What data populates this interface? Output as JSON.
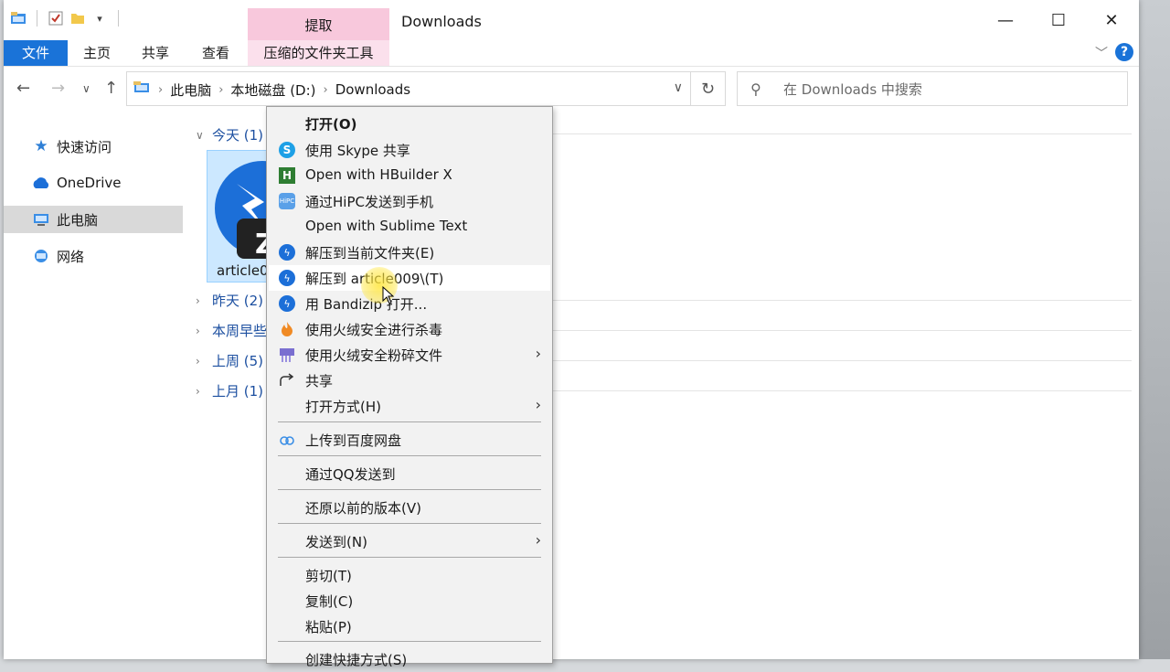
{
  "window": {
    "title": "Downloads",
    "context_tab": "提取",
    "minimize": "—",
    "maximize": "☐",
    "close": "✕"
  },
  "ribbon": {
    "tabs": [
      "文件",
      "主页",
      "共享",
      "查看",
      "压缩的文件夹工具"
    ],
    "help": "?"
  },
  "address": {
    "crumbs": [
      "此电脑",
      "本地磁盘 (D:)",
      "Downloads"
    ]
  },
  "search": {
    "placeholder": "在 Downloads 中搜索"
  },
  "nav_pane": {
    "items": [
      "快速访问",
      "OneDrive",
      "此电脑",
      "网络"
    ]
  },
  "content": {
    "groups": [
      "今天 (1)",
      "昨天 (2)",
      "本周早些",
      "上周 (5)",
      "上月 (1)"
    ],
    "file_label": "article0"
  },
  "context_menu": {
    "items": [
      "打开(O)",
      "使用 Skype 共享",
      "Open with HBuilder X",
      "通过HiPC发送到手机",
      "Open with Sublime Text",
      "解压到当前文件夹(E)",
      "解压到 article009\\(T)",
      "用 Bandizip 打开...",
      "使用火绒安全进行杀毒",
      "使用火绒安全粉碎文件",
      "共享",
      "打开方式(H)",
      "上传到百度网盘",
      "通过QQ发送到",
      "还原以前的版本(V)",
      "发送到(N)",
      "剪切(T)",
      "复制(C)",
      "粘贴(P)",
      "创建快捷方式(S)"
    ],
    "hipc_badge": "HiPC"
  },
  "colors": {
    "accent": "#1a73d8",
    "context_tab": "#f8c8dc",
    "selection": "#cce8ff",
    "menu_bg": "#f2f2f2"
  }
}
